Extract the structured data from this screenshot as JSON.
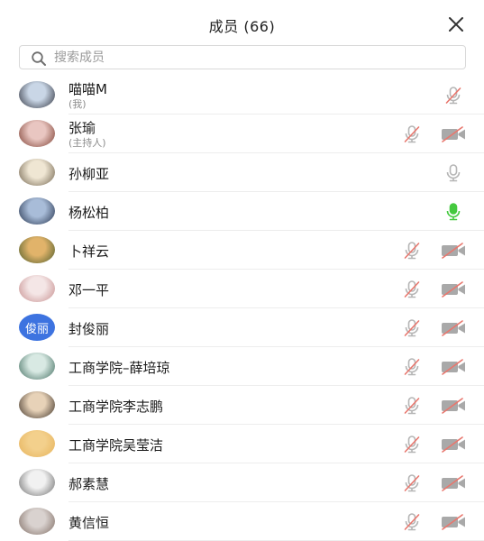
{
  "header": {
    "title": "成员 (66)",
    "close_icon": "close-icon"
  },
  "search": {
    "placeholder": "搜索成员",
    "icon": "search-icon"
  },
  "colors": {
    "muted_mic": "#b5b5b5",
    "mute_slash": "#e8776e",
    "active_mic": "#45c93f",
    "off_camera": "#a9a9a9"
  },
  "members": [
    {
      "name": "喵喵M",
      "sub": "(我)",
      "mic": "muted",
      "camera": false,
      "avatar": {
        "kind": "image",
        "c1": "#c9d6e6",
        "c2": "#2c2f3a"
      }
    },
    {
      "name": "张瑜",
      "sub": "(主持人)",
      "mic": "muted",
      "camera": "off",
      "avatar": {
        "kind": "image",
        "c1": "#e9c6c1",
        "c2": "#7a3b2e"
      }
    },
    {
      "name": "孙柳亚",
      "mic": "idle",
      "camera": false,
      "avatar": {
        "kind": "image",
        "c1": "#efe6d3",
        "c2": "#6d5f4a"
      }
    },
    {
      "name": "杨松柏",
      "mic": "active",
      "camera": false,
      "avatar": {
        "kind": "image",
        "c1": "#a8bcd8",
        "c2": "#22304a"
      }
    },
    {
      "name": "卜祥云",
      "mic": "muted",
      "camera": "off",
      "avatar": {
        "kind": "image",
        "c1": "#e1b36a",
        "c2": "#4a5b2a"
      }
    },
    {
      "name": "邓一平",
      "mic": "muted",
      "camera": "off",
      "avatar": {
        "kind": "image",
        "c1": "#f4e6e6",
        "c2": "#c58c8c"
      }
    },
    {
      "name": "封俊丽",
      "mic": "muted",
      "camera": "off",
      "avatar": {
        "kind": "text",
        "text": "俊丽",
        "color": "#3d73e0"
      }
    },
    {
      "name": "工商学院–薛培琼",
      "mic": "muted",
      "camera": "off",
      "avatar": {
        "kind": "image",
        "c1": "#d8e9e3",
        "c2": "#3e6a5c"
      }
    },
    {
      "name": "工商学院李志鹏",
      "mic": "muted",
      "camera": "off",
      "avatar": {
        "kind": "image",
        "c1": "#e7d2b8",
        "c2": "#3a2e24"
      }
    },
    {
      "name": "工商学院吴莹洁",
      "mic": "muted",
      "camera": "off",
      "avatar": {
        "kind": "image",
        "c1": "#f3d08c",
        "c2": "#e6b25a"
      }
    },
    {
      "name": "郝素慧",
      "mic": "muted",
      "camera": "off",
      "avatar": {
        "kind": "image",
        "c1": "#f1f1f1",
        "c2": "#6a6a6a"
      }
    },
    {
      "name": "黄信恒",
      "mic": "muted",
      "camera": "off",
      "avatar": {
        "kind": "image",
        "c1": "#d9d2cf",
        "c2": "#7d6a61"
      }
    }
  ]
}
